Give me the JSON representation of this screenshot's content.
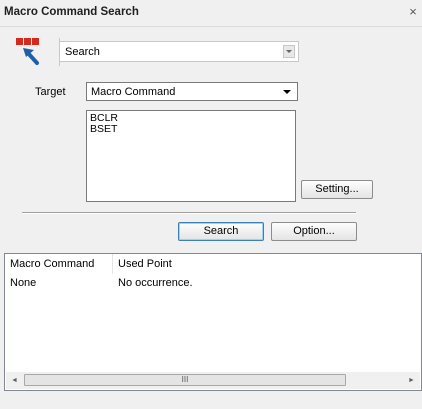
{
  "window": {
    "title": "Macro Command Search",
    "close_glyph": "×"
  },
  "mode": {
    "icon": "macro-search-icon",
    "value": "Search"
  },
  "target": {
    "label": "Target",
    "selected": "Macro Command"
  },
  "list_items": [
    "BCLR",
    "BSET"
  ],
  "buttons": {
    "setting": "Setting...",
    "search": "Search",
    "option": "Option..."
  },
  "results": {
    "columns": [
      "Macro Command",
      "Used Point"
    ],
    "rows": [
      [
        "None",
        "No occurrence."
      ]
    ]
  },
  "scrollbar": {
    "left": "◄",
    "right": "►",
    "grip": "III"
  },
  "colors": {
    "accent": "#3c7fb1",
    "icon_red": "#d42a1e",
    "icon_blue": "#1f5fa8"
  }
}
